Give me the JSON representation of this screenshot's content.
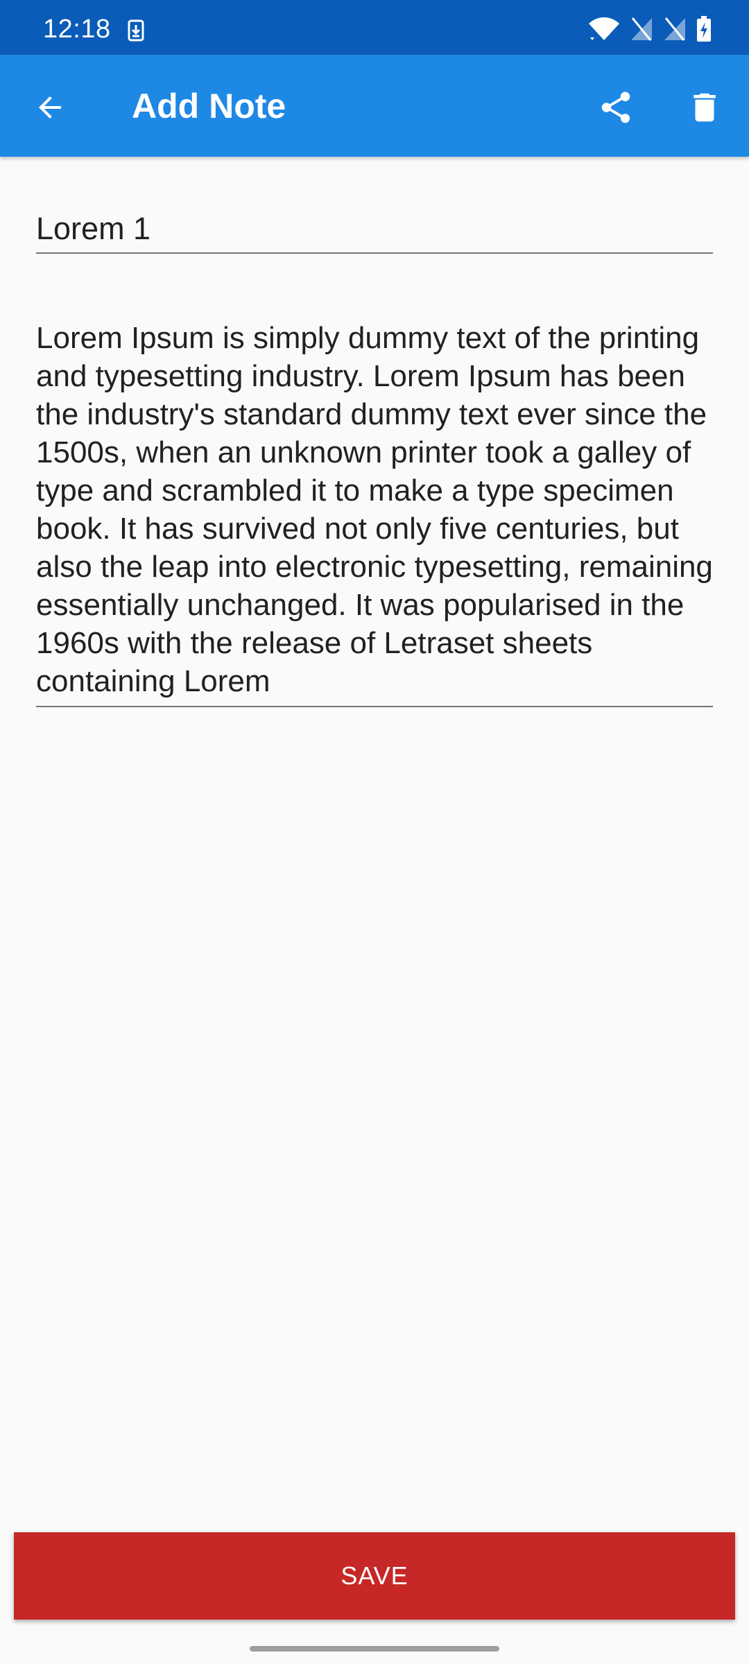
{
  "status_bar": {
    "time": "12:18",
    "icons": [
      "download-icon",
      "wifi-icon",
      "signal-off-icon",
      "signal-off-icon",
      "battery-charging-icon"
    ]
  },
  "app_bar": {
    "title": "Add Note",
    "back_icon": "arrow-back-icon",
    "share_icon": "share-icon",
    "delete_icon": "trash-icon"
  },
  "form": {
    "title_value": "Lorem 1",
    "body_value": "Lorem Ipsum is simply dummy text of the printing and typesetting industry. Lorem Ipsum has been the industry's standard dummy text ever since the 1500s, when an unknown printer took a galley of type and scrambled it to make a type specimen book. It has survived not only five centuries, but also the leap into electronic typesetting, remaining essentially unchanged. It was popularised in the 1960s with the release of Letraset sheets containing Lorem"
  },
  "actions": {
    "save_label": "SAVE"
  },
  "colors": {
    "status_bar": "#0a5cb8",
    "app_bar": "#1e88e5",
    "save_button": "#c62828",
    "background": "#fafafa"
  }
}
